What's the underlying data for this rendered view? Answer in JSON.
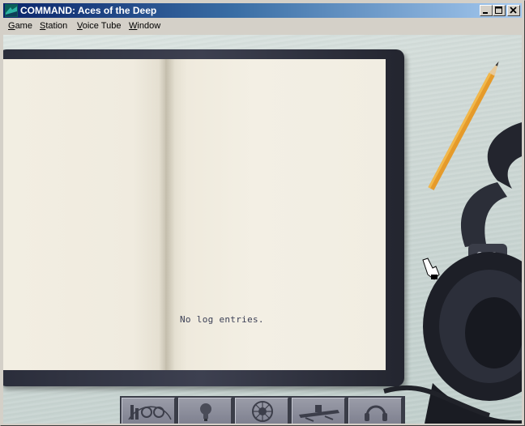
{
  "window": {
    "title": "COMMAND: Aces of the Deep",
    "controls": [
      "minimize",
      "maximize",
      "close"
    ]
  },
  "menubar": {
    "items": [
      {
        "label": "Game",
        "accelerator": "G",
        "rest": "ame"
      },
      {
        "label": "Station",
        "accelerator": "S",
        "rest": "tation"
      },
      {
        "label": "Voice Tube",
        "accelerator": "V",
        "rest": "oice Tube"
      },
      {
        "label": "Window",
        "accelerator": "W",
        "rest": "indow"
      }
    ]
  },
  "logbook": {
    "empty_message": "No log entries."
  },
  "station_toolbar": {
    "buttons": [
      {
        "name": "gauges-station",
        "icon": "gauge-icon"
      },
      {
        "name": "lightbulb-station",
        "icon": "lightbulb-icon"
      },
      {
        "name": "compass-station",
        "icon": "compass-icon"
      },
      {
        "name": "submarine-station",
        "icon": "submarine-icon"
      },
      {
        "name": "headphones-station",
        "icon": "headphones-icon"
      }
    ]
  },
  "colors": {
    "titlebar_start": "#0a246a",
    "titlebar_end": "#a6caf0",
    "desk": "#cfd9d6",
    "paper": "#f1ede2",
    "binder": "#2f3240",
    "log_text": "#3b3f55"
  }
}
